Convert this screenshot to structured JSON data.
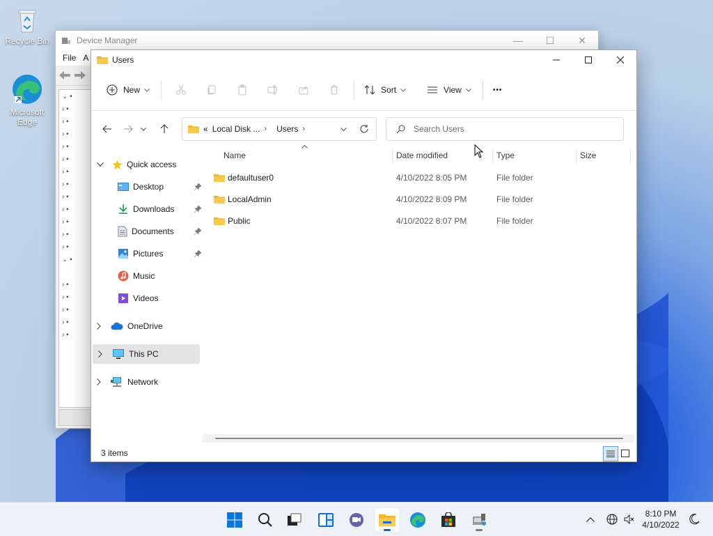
{
  "desktop": {
    "icons": [
      {
        "label": "Recycle Bin"
      },
      {
        "label": "Microsoft Edge"
      }
    ]
  },
  "device_manager": {
    "title": "Device Manager",
    "menu": [
      "File",
      "A"
    ]
  },
  "explorer": {
    "title": "Users",
    "toolbar": {
      "new_label": "New",
      "sort_label": "Sort",
      "view_label": "View",
      "more_label": "•••"
    },
    "address": {
      "prefix": "«",
      "crumbs": [
        "Local Disk ...",
        "Users"
      ],
      "separator": "›"
    },
    "search": {
      "placeholder": "Search Users"
    },
    "nav": {
      "quick_access": "Quick access",
      "items": [
        {
          "label": "Desktop"
        },
        {
          "label": "Downloads"
        },
        {
          "label": "Documents"
        },
        {
          "label": "Pictures"
        },
        {
          "label": "Music"
        },
        {
          "label": "Videos"
        }
      ],
      "onedrive": "OneDrive",
      "this_pc": "This PC",
      "network": "Network"
    },
    "columns": {
      "name": "Name",
      "date": "Date modified",
      "type": "Type",
      "size": "Size"
    },
    "files": [
      {
        "name": "defaultuser0",
        "date": "4/10/2022 8:05 PM",
        "type": "File folder"
      },
      {
        "name": "LocalAdmin",
        "date": "4/10/2022 8:09 PM",
        "type": "File folder"
      },
      {
        "name": "Public",
        "date": "4/10/2022 8:07 PM",
        "type": "File folder"
      }
    ],
    "status": "3 items"
  },
  "taskbar": {
    "time": "8:10 PM",
    "date": "4/10/2022"
  },
  "colors": {
    "folder": "#f8c44f",
    "accent": "#0067c0",
    "taskbar": "#eef1f6"
  }
}
